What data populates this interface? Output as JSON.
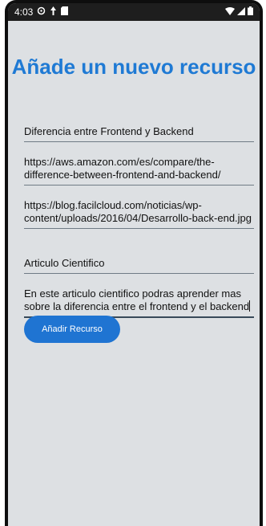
{
  "status_bar": {
    "time": "4:03",
    "icons_left": [
      "sync-icon",
      "navigation-icon",
      "sd-card-icon"
    ],
    "icons_right": [
      "wifi-icon",
      "signal-icon",
      "battery-icon"
    ]
  },
  "form": {
    "title": "Añade un nuevo recurso",
    "fields": [
      {
        "name": "title",
        "value": "Diferencia entre Frontend y Backend"
      },
      {
        "name": "url",
        "value": "https://aws.amazon.com/es/compare/the-difference-between-frontend-and-backend/"
      },
      {
        "name": "image-url",
        "value": "https://blog.facilcloud.com/noticias/wp-content/uploads/2016/04/Desarrollo-back-end.jpg"
      },
      {
        "name": "category",
        "value": "Articulo Cientifico"
      },
      {
        "name": "description",
        "value": "En este articulo cientifico podras aprender mas sobre la diferencia entre el frontend y el backend"
      }
    ],
    "submit_label": "Añadir Recurso"
  },
  "colors": {
    "accent": "#1f7ad4",
    "button": "#1f74d2",
    "background": "#dde0e3"
  }
}
